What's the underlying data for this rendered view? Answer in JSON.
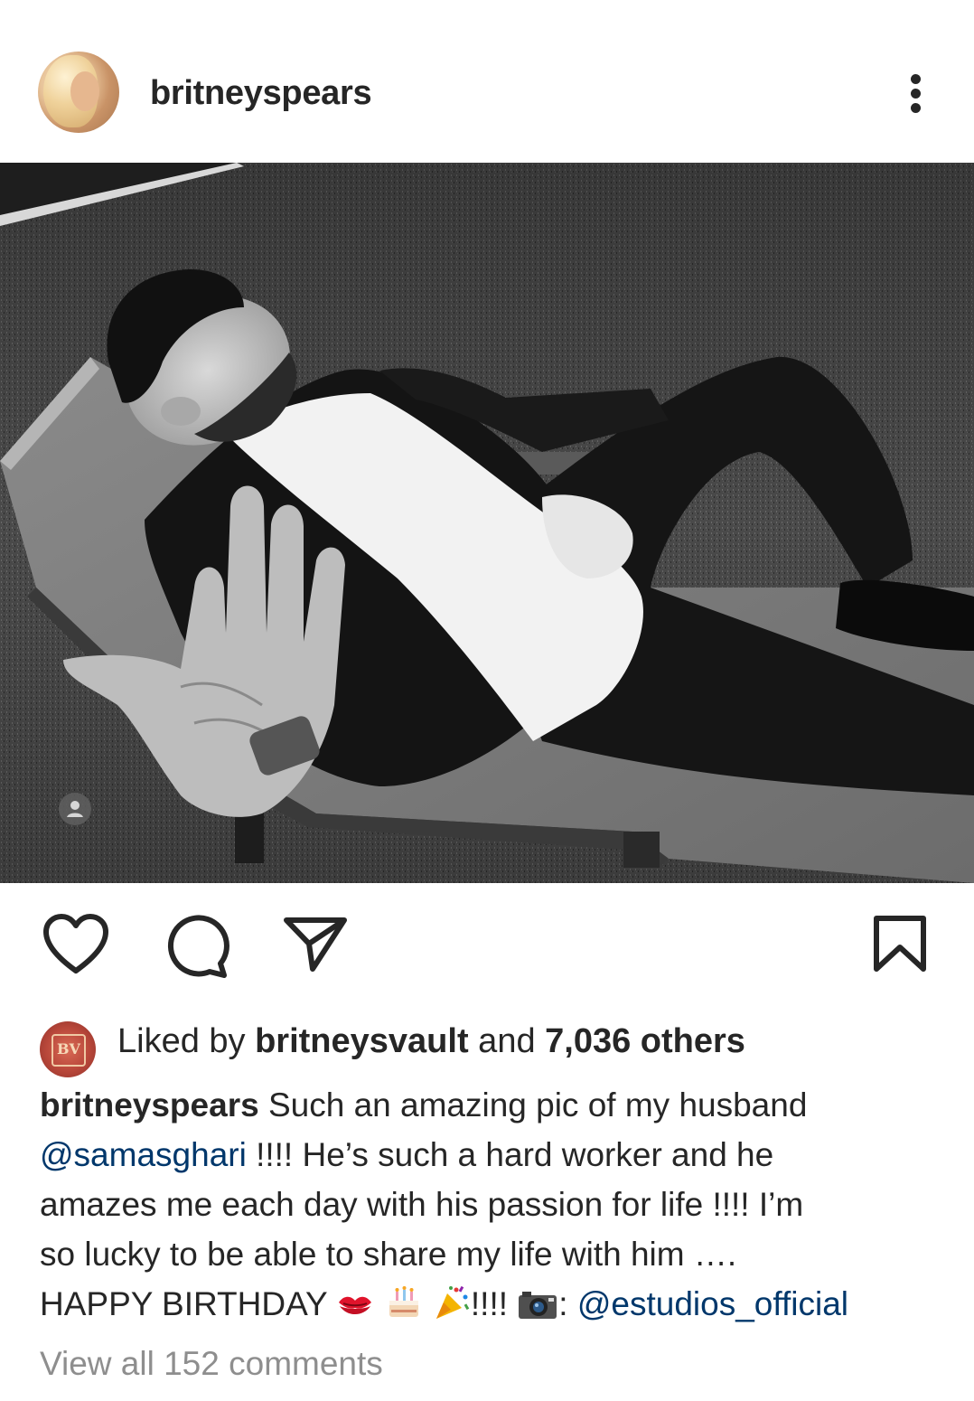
{
  "header": {
    "username": "britneyspears",
    "avatar_icon": "profile-avatar",
    "more_icon": "more-vertical-icon"
  },
  "post": {
    "image_icon": "photo",
    "tag_icon": "user-tag-icon"
  },
  "actions": {
    "like_icon": "heart-icon",
    "comment_icon": "comment-icon",
    "share_icon": "send-icon",
    "save_icon": "bookmark-icon"
  },
  "likes": {
    "prefix": "Liked by ",
    "user": "britneysvault",
    "middle": " and ",
    "count": "7,036 others",
    "avatar_text": "BV"
  },
  "caption": {
    "author": "britneyspears",
    "line1_text": " Such an amazing pic of my husband",
    "mention1": "@samasghari",
    "line2_text": " !!!! He’s such a hard worker and he",
    "line3_text": "amazes me each day with his passion for life !!!! I’m",
    "line4_text": "so lucky to be able to share my life with him ….",
    "line5_text": "HAPPY BIRTHDAY",
    "line5_mid": "!!!!",
    "line5_colon": ": ",
    "mention2": "@estudios_official",
    "emojis": [
      "kiss-mark",
      "birthday-cake",
      "party-popper",
      "camera"
    ]
  },
  "comments": {
    "label": "View all 152 comments"
  },
  "colors": {
    "text": "#262626",
    "mention": "#00376b",
    "muted": "#8e8e8e",
    "background": "#ffffff"
  }
}
